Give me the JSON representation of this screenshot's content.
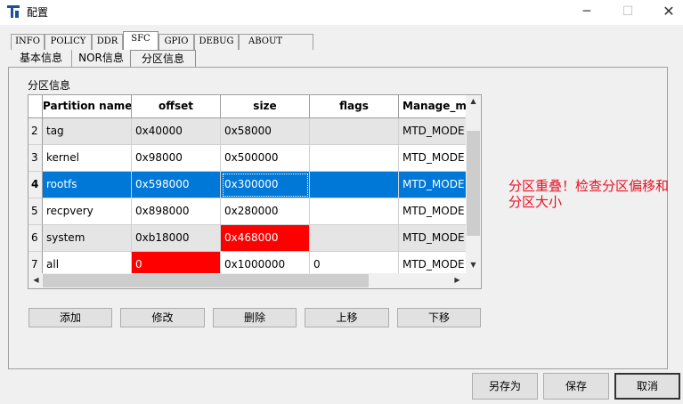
{
  "window": {
    "title": "配置",
    "min_glyph": "─",
    "max_glyph": "☐",
    "close_glyph": "✕"
  },
  "main_tabs": [
    "INFO",
    "POLICY",
    "DDR",
    "SFC",
    "GPIO",
    "DEBUG",
    "ABOUT"
  ],
  "active_main_tab": "SFC",
  "sub_tabs": [
    "基本信息",
    "NOR信息",
    "分区信息"
  ],
  "active_sub_tab": "分区信息",
  "group_label": "分区信息",
  "table": {
    "columns": [
      "Partition name",
      "offset",
      "size",
      "flags",
      "Manage_mo"
    ],
    "rows": [
      {
        "num": "2",
        "name": "tag",
        "offset": "0x40000",
        "size": "0x58000",
        "flags": "",
        "manage": "MTD_MODE"
      },
      {
        "num": "3",
        "name": "kernel",
        "offset": "0x98000",
        "size": "0x500000",
        "flags": "",
        "manage": "MTD_MODE"
      },
      {
        "num": "4",
        "name": "rootfs",
        "offset": "0x598000",
        "size": "0x300000",
        "flags": "",
        "manage": "MTD_MODE"
      },
      {
        "num": "5",
        "name": "recpvery",
        "offset": "0x898000",
        "size": "0x280000",
        "flags": "",
        "manage": "MTD_MODE"
      },
      {
        "num": "6",
        "name": "system",
        "offset": "0xb18000",
        "size": "0x468000",
        "flags": "",
        "manage": "MTD_MODE"
      },
      {
        "num": "7",
        "name": "all",
        "offset": "0",
        "size": "0x1000000",
        "flags": "0",
        "manage": "MTD_MODE"
      }
    ],
    "selected_row": "4",
    "error_color": "#ff0000",
    "selection_color": "#0078d7"
  },
  "action_buttons": [
    "添加",
    "修改",
    "删除",
    "上移",
    "下移"
  ],
  "warning_text": "分区重叠！检查分区偏移和分区大小",
  "warning_color": "#e81123",
  "footer_buttons": [
    "另存为",
    "保存",
    "取消"
  ]
}
